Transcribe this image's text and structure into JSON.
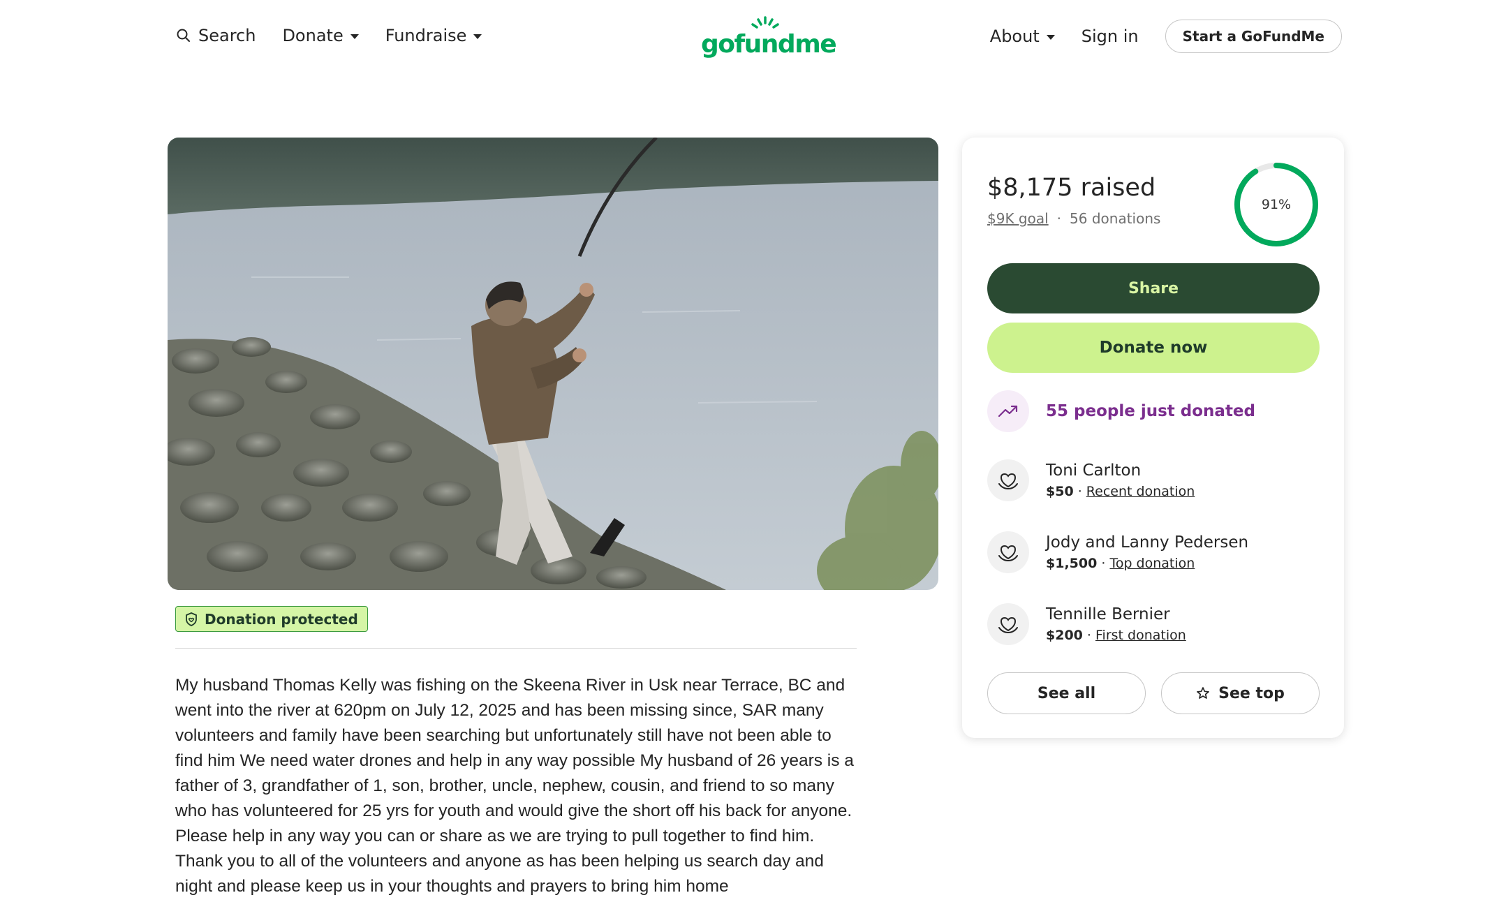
{
  "header": {
    "search_label": "Search",
    "donate_label": "Donate",
    "fundraise_label": "Fundraise",
    "logo_text": "gofundme",
    "about_label": "About",
    "signin_label": "Sign in",
    "start_label": "Start a GoFundMe"
  },
  "colors": {
    "brand": "#02a95c",
    "share_bg": "#2a4a32",
    "donate_bg": "#cdf28e",
    "trend_purple": "#7b2e8e",
    "protect_bg": "#d5f5a6"
  },
  "media": {
    "hero_alt": "Man fishing on river bank"
  },
  "protection": {
    "label": "Donation protected"
  },
  "story": {
    "text": "My husband Thomas Kelly was fishing on the Skeena River in Usk near Terrace, BC and went into the river at 620pm on July 12, 2025 and has been missing since, SAR many volunteers and family have been searching but unfortunately still have not been able to find him We need water drones and help in any way possible My husband of 26 years is a father of 3, grandfather of 1, son, brother, uncle, nephew, cousin, and friend to so many who has volunteered for 25 yrs for youth and would give the short off his back for anyone. Please help in any way you can or share as we are trying to pull together to find him. Thank you to all of the volunteers and anyone as has been helping us search day and night and please keep us in your thoughts and prayers to bring him home"
  },
  "progress": {
    "raised": "$8,175",
    "raised_suffix": "raised",
    "goal": "$9K goal",
    "separator": "·",
    "donations": "56 donations",
    "percent_label": "91%",
    "percent": 0.91
  },
  "actions": {
    "share": "Share",
    "donate": "Donate now",
    "see_all": "See all",
    "see_top": "See top"
  },
  "activity": {
    "trend_text": "55 people just donated",
    "donors": [
      {
        "name": "Toni Carlton",
        "amount": "$50",
        "sep": " · ",
        "tag": "Recent donation"
      },
      {
        "name": "Jody and Lanny Pedersen",
        "amount": "$1,500",
        "sep": " · ",
        "tag": "Top donation"
      },
      {
        "name": "Tennille Bernier",
        "amount": "$200",
        "sep": " · ",
        "tag": "First donation"
      }
    ]
  }
}
